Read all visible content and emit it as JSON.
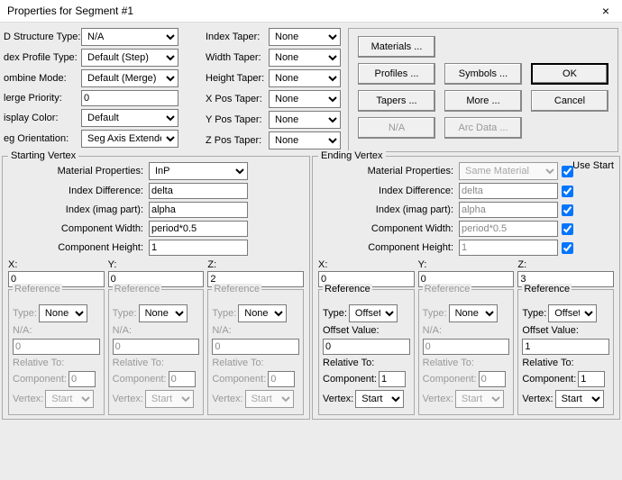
{
  "window": {
    "title": "Properties for Segment #1",
    "close": "×"
  },
  "labels": {
    "structType": "D Structure Type:",
    "profileType": "dex Profile Type:",
    "combineMode": "ombine Mode:",
    "mergePriority": "lerge Priority:",
    "displayColor": "isplay Color:",
    "segOrientation": "eg Orientation:",
    "indexTaper": "Index Taper:",
    "widthTaper": "Width Taper:",
    "heightTaper": "Height Taper:",
    "xPosTaper": "X Pos Taper:",
    "yPosTaper": "Y Pos Taper:",
    "zPosTaper": "Z Pos Taper:"
  },
  "values": {
    "structType": "N/A",
    "profileType": "Default (Step)",
    "combineMode": "Default (Merge)",
    "mergePriority": "0",
    "displayColor": "Default",
    "segOrientation": "Seg Axis Extended",
    "indexTaper": "None",
    "widthTaper": "None",
    "heightTaper": "None",
    "xPosTaper": "None",
    "yPosTaper": "None",
    "zPosTaper": "None"
  },
  "buttons": {
    "materials": "Materials ...",
    "profiles": "Profiles ...",
    "symbols": "Symbols ...",
    "ok": "OK",
    "tapers": "Tapers ...",
    "more": "More ...",
    "cancel": "Cancel",
    "na": "N/A",
    "arcData": "Arc Data ..."
  },
  "vertex": {
    "startTitle": "Starting Vertex",
    "endTitle": "Ending Vertex",
    "useStart": "Use Start",
    "props": {
      "matProp": "Material Properties:",
      "idxDiff": "Index Difference:",
      "idxImag": "Index (imag part):",
      "compW": "Component Width:",
      "compH": "Component Height:"
    },
    "start": {
      "matProp": "InP",
      "idxDiff": "delta",
      "idxImag": "alpha",
      "compW": "period*0.5",
      "compH": "1"
    },
    "end": {
      "matProp": "Same Material",
      "idxDiff": "delta",
      "idxImag": "alpha",
      "compW": "period*0.5",
      "compH": "1"
    },
    "xyz": {
      "x": "X:",
      "y": "Y:",
      "z": "Z:"
    },
    "startXYZ": {
      "x": "0",
      "y": "0",
      "z": "2"
    },
    "endXYZ": {
      "x": "0",
      "y": "0",
      "z": "3"
    },
    "ref": {
      "title": "Reference",
      "type": "Type:",
      "na": "N/A:",
      "offsetVal": "Offset Value:",
      "relTo": "Relative To:",
      "component": "Component:",
      "vertex": "Vertex:",
      "none": "None",
      "offset": "Offset",
      "start": "Start",
      "zero": "0",
      "one": "1"
    }
  }
}
